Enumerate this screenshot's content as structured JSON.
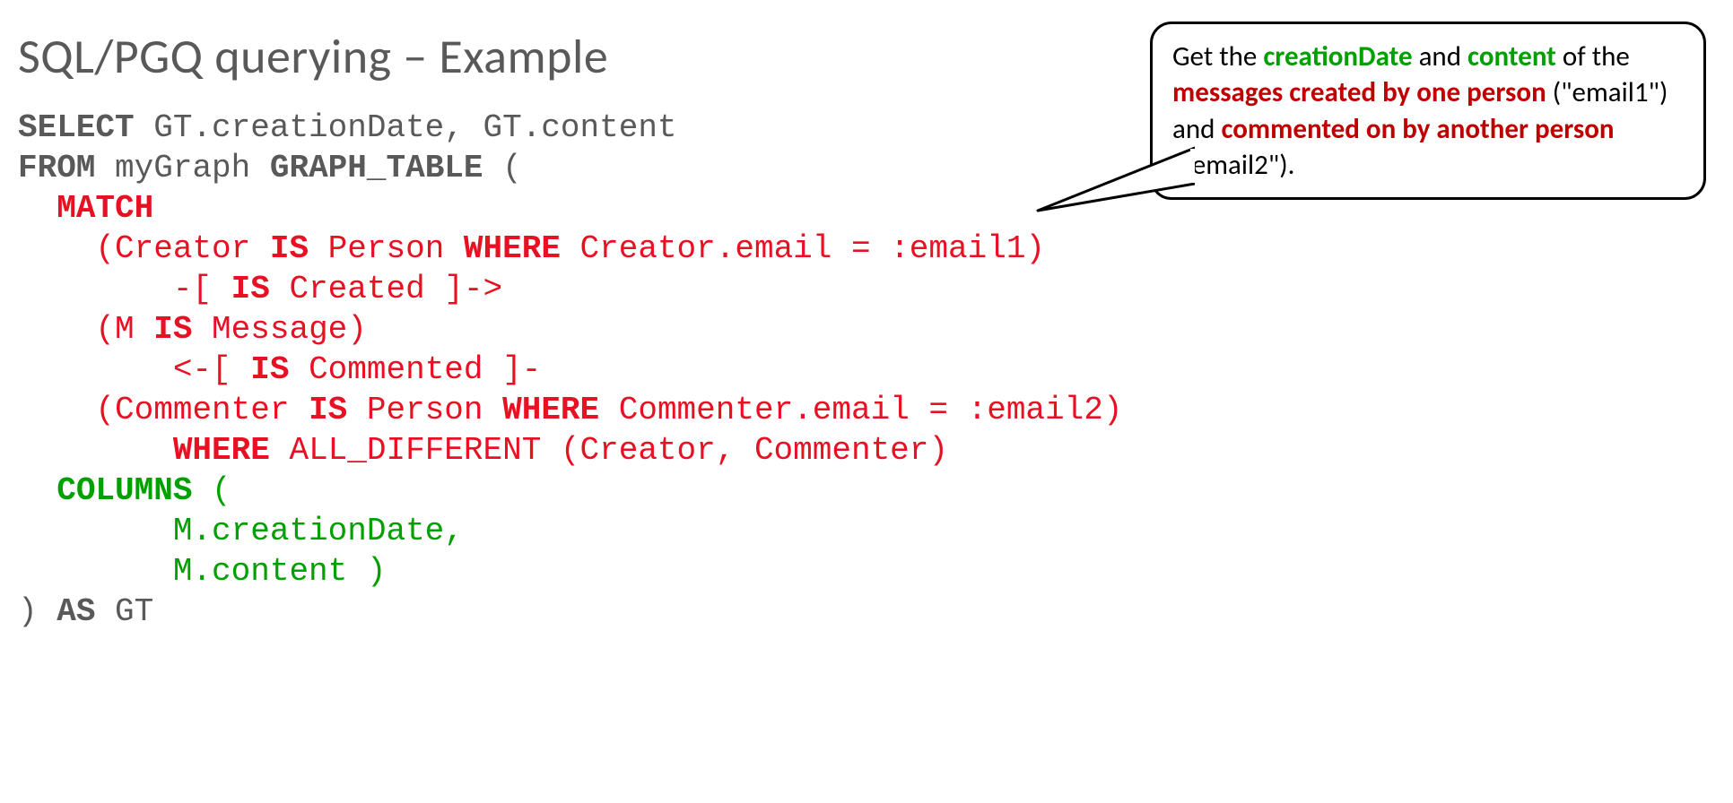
{
  "title": "SQL/PGQ querying – Example",
  "code": {
    "l1_select": "SELECT",
    "l1_rest": " GT.creationDate, GT.content",
    "l2_from": "FROM",
    "l2_mid": " myGraph ",
    "l2_gt": "GRAPH_TABLE",
    "l2_paren": " (",
    "l3_indent": "  ",
    "l3_match": "MATCH",
    "l4_indent": "    ",
    "l4_a": "(Creator ",
    "l4_is": "IS",
    "l4_b": " Person ",
    "l4_where": "WHERE",
    "l4_c": " Creator.email = :email1)",
    "l5_indent": "        ",
    "l5_a": "-[ ",
    "l5_is": "IS",
    "l5_b": " Created ]->",
    "l6_indent": "    ",
    "l6_a": "(M ",
    "l6_is": "IS",
    "l6_b": " Message)",
    "l7_indent": "        ",
    "l7_a": "<-[ ",
    "l7_is": "IS",
    "l7_b": " Commented ]-",
    "l8_indent": "    ",
    "l8_a": "(Commenter ",
    "l8_is": "IS",
    "l8_b": " Person ",
    "l8_where": "WHERE",
    "l8_c": " Commenter.email = :email2)",
    "l9_indent": "        ",
    "l9_where": "WHERE",
    "l9_rest": " ALL_DIFFERENT (Creator, Commenter)",
    "l10_indent": "  ",
    "l10_cols": "COLUMNS",
    "l10_paren": " (",
    "l11_indent": "        ",
    "l11_val": "M.creationDate,",
    "l12_indent": "        ",
    "l12_val": "M.content )",
    "l13_close": ") ",
    "l13_as": "AS",
    "l13_gt": " GT"
  },
  "bubble": {
    "t1": "Get the ",
    "t2": "creationDate",
    "t3": " and ",
    "t4": "content",
    "t5": " of the ",
    "t6": "messages created by one person",
    "t7": " (\"email1\") and ",
    "t8": "commented on by another person",
    "t9": " (\"email2\")."
  }
}
